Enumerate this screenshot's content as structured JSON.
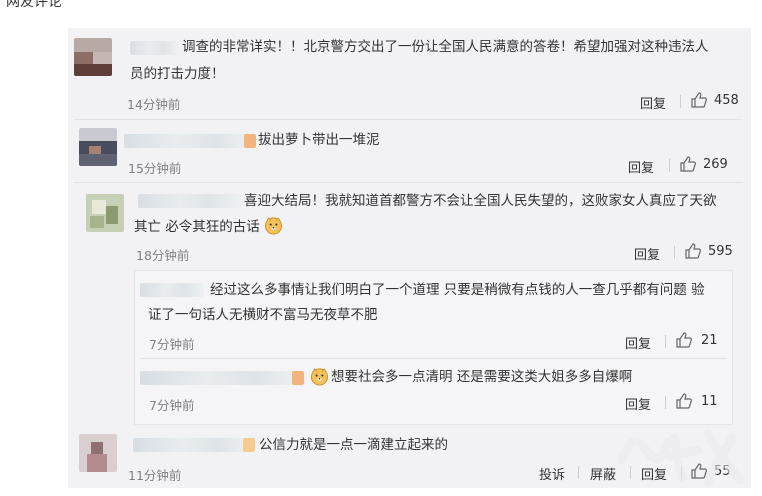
{
  "page_header": {
    "cut_text": "网友评论"
  },
  "comments": [
    {
      "text_line1": "调查的非常详实！！北京警方交出了一份让全国人民满意的答卷！希望加强对这种违法人",
      "text_line2": "员的打击力度！",
      "time": "14分钟前",
      "reply_label": "回复",
      "likes": "458"
    },
    {
      "text_line1": "拔出萝卜带出一堆泥",
      "time": "15分钟前",
      "reply_label": "回复",
      "likes": "269"
    },
    {
      "text_line1": "喜迎大结局！我就知道首都警方不会让全国人民失望的，这败家女人真应了天欲",
      "text_line2": "其亡 必令其狂的古话",
      "time": "18分钟前",
      "reply_label": "回复",
      "likes": "595"
    },
    {
      "text_line1": "经过这么多事情让我们明白了一个道理 只要是稍微有点钱的人一查几乎都有问题 验",
      "text_line2": "证了一句话人无横财不富马无夜草不肥",
      "time": "7分钟前",
      "reply_label": "回复",
      "likes": "21"
    },
    {
      "text_line1": "想要社会多一点清明 还是需要这类大姐多多自爆啊",
      "time": "7分钟前",
      "reply_label": "回复",
      "likes": "11"
    },
    {
      "text_line1": "公信力就是一点一滴建立起来的",
      "time": "11分钟前",
      "report_label": "投诉",
      "block_label": "屏蔽",
      "reply_label": "回复",
      "likes": "55"
    }
  ],
  "icons": {
    "like": "thumbs-up-icon",
    "emoji": "doge-emoji-icon"
  },
  "colors": {
    "panel_bg": "#f2f2f5",
    "time": "#808080",
    "blur_accent": "#f2b37c"
  }
}
